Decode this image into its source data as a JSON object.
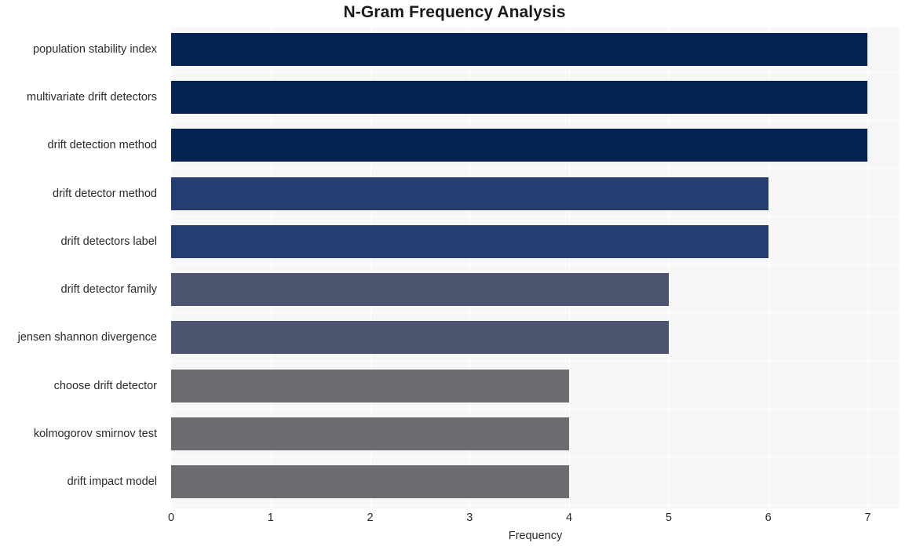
{
  "chart_data": {
    "type": "bar",
    "orientation": "horizontal",
    "title": "N-Gram Frequency Analysis",
    "xlabel": "Frequency",
    "ylabel": "",
    "xlim": [
      0,
      7.32
    ],
    "xticks": [
      0,
      1,
      2,
      3,
      4,
      5,
      6,
      7
    ],
    "xtick_labels": [
      "0",
      "1",
      "2",
      "3",
      "4",
      "5",
      "6",
      "7"
    ],
    "grid": true,
    "legend": null,
    "categories": [
      "population stability index",
      "multivariate drift detectors",
      "drift detection method",
      "drift detector method",
      "drift detectors label",
      "drift detector family",
      "jensen shannon divergence",
      "choose drift detector",
      "kolmogorov smirnov test",
      "drift impact model"
    ],
    "values": [
      7,
      7,
      7,
      6,
      6,
      5,
      5,
      4,
      4,
      4
    ],
    "bar_colors": [
      "#032350",
      "#032350",
      "#032350",
      "#253d70",
      "#253d70",
      "#4d5470",
      "#4d5470",
      "#6b6c70",
      "#6b6c70",
      "#6b6c70"
    ],
    "plot_background": "#f7f7f7",
    "gridline_color": "#ffffff",
    "figure_background": "#ffffff",
    "text_color": "#2b2b2b"
  }
}
